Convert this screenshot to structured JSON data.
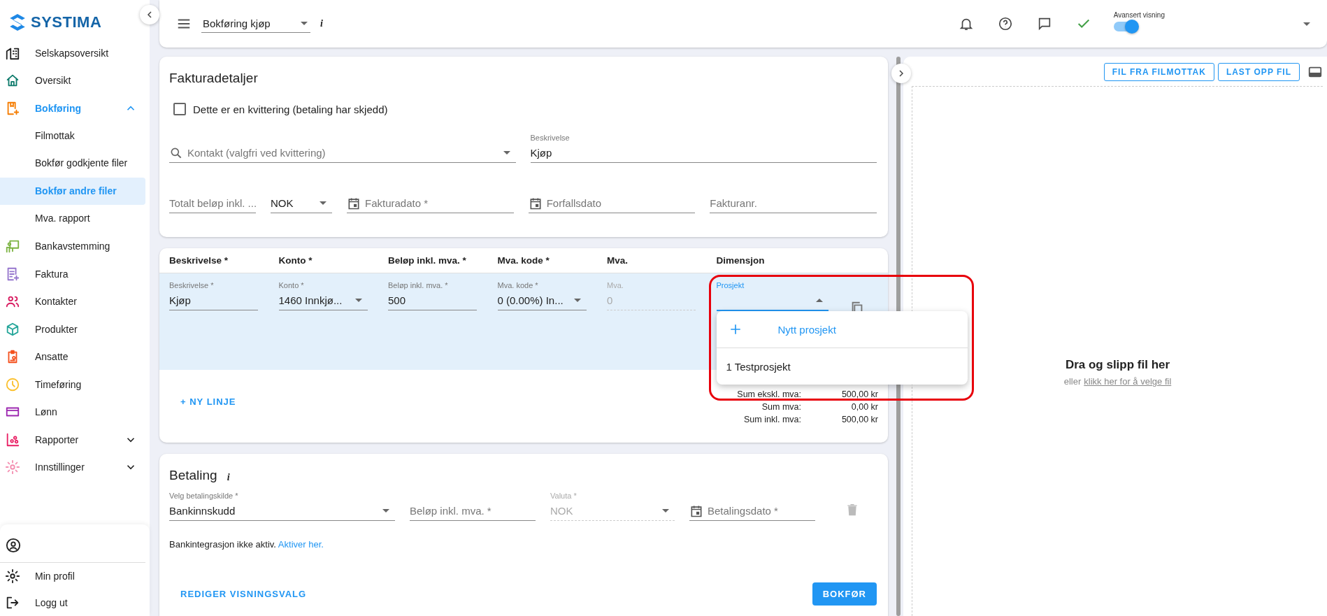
{
  "sidebar": {
    "logo": "SYSTIMA",
    "items": [
      {
        "label": "Selskapsoversikt",
        "selected": false
      },
      {
        "label": "Oversikt",
        "selected": false
      },
      {
        "label": "Bokføring",
        "selected": true,
        "expanded": true,
        "children": [
          {
            "label": "Filmottak",
            "selected": false
          },
          {
            "label": "Bokfør godkjente filer",
            "selected": false
          },
          {
            "label": "Bokfør andre filer",
            "selected": true
          },
          {
            "label": "Mva. rapport",
            "selected": false
          }
        ]
      },
      {
        "label": "Bankavstemming",
        "selected": false
      },
      {
        "label": "Faktura",
        "selected": false
      },
      {
        "label": "Kontakter",
        "selected": false
      },
      {
        "label": "Produkter",
        "selected": false
      },
      {
        "label": "Ansatte",
        "selected": false
      },
      {
        "label": "Timeføring",
        "selected": false
      },
      {
        "label": "Lønn",
        "selected": false
      },
      {
        "label": "Rapporter",
        "selected": false,
        "expanded": false
      },
      {
        "label": "Innstillinger",
        "selected": false,
        "expanded": false
      }
    ],
    "footer_items": [
      "Min profil",
      "Logg ut"
    ]
  },
  "top_bar": {
    "view_select": "Bokføring kjøp",
    "info": "i",
    "toggle": {
      "label": "Avansert visning",
      "on": true
    }
  },
  "invoice_details": {
    "title": "Fakturadetaljer",
    "receipt_checkbox": {
      "label": "Dette er en kvittering (betaling har skjedd)",
      "checked": false
    },
    "row_1": [
      {
        "kind": "search",
        "placeholder": "Kontakt (valgfri ved kvittering)"
      },
      {
        "kind": "text",
        "label": "Beskrivelse",
        "value": "Kjøp"
      }
    ],
    "row_2": [
      {
        "kind": "text",
        "placeholder": "Totalt beløp inkl. ..."
      },
      {
        "kind": "select",
        "value": "NOK"
      },
      {
        "kind": "date",
        "placeholder": "Fakturadato *"
      },
      {
        "kind": "date",
        "placeholder": "Forfallsdato"
      },
      {
        "kind": "text",
        "placeholder": "Fakturanr."
      }
    ]
  },
  "lines": {
    "columns": [
      "Beskrivelse *",
      "Konto *",
      "Beløp inkl. mva. *",
      "Mva. kode *",
      "Mva.",
      "Dimensjon"
    ],
    "rows": [
      {
        "selected": true,
        "cells": [
          {
            "kind": "text",
            "label": "Beskrivelse *",
            "value": "Kjøp"
          },
          {
            "kind": "select",
            "label": "Konto *",
            "value": "1460 Innkjø..."
          },
          {
            "kind": "text",
            "label": "Beløp inkl. mva. *",
            "value": "500"
          },
          {
            "kind": "select",
            "label": "Mva. kode *",
            "value": "0 (0.00%) In..."
          },
          {
            "kind": "text",
            "label": "Mva.",
            "value": "0",
            "disabled": true
          },
          {
            "kind": "select",
            "label": "Prosjekt",
            "open": true,
            "menu": [
              {
                "kind": "add",
                "label": "Nytt prosjekt"
              },
              {
                "kind": "option",
                "label": "1 Testprosjekt"
              }
            ]
          }
        ]
      }
    ],
    "add_line": "+ NY LINJE",
    "sums": [
      {
        "label": "Sum ekskl. mva:",
        "value": "500,00 kr"
      },
      {
        "label": "Sum mva:",
        "value": "0,00 kr"
      },
      {
        "label": "Sum inkl. mva:",
        "value": "500,00 kr"
      }
    ]
  },
  "payment": {
    "title": "Betaling",
    "info": "i",
    "fields": [
      {
        "kind": "select",
        "label": "Velg betalingskilde *",
        "value": "Bankinnskudd"
      },
      {
        "kind": "text",
        "placeholder": "Beløp inkl. mva. *"
      },
      {
        "kind": "select",
        "label": "Valuta *",
        "value": "NOK",
        "disabled": true
      },
      {
        "kind": "date",
        "placeholder": "Betalingsdato *"
      }
    ],
    "notice": "Bankintegrasjon ikke aktiv.",
    "notice_link": "Aktiver her.",
    "edit_view_button": "REDIGER VISNINGSVALG",
    "submit_button": "BOKFØR"
  },
  "file_panel": {
    "buttons": [
      "FIL FRA FILMOTTAK",
      "LAST OPP FIL"
    ],
    "drop_title": "Dra og slipp fil her",
    "drop_hint": "eller",
    "drop_link": "klikk her for å velge fil"
  }
}
